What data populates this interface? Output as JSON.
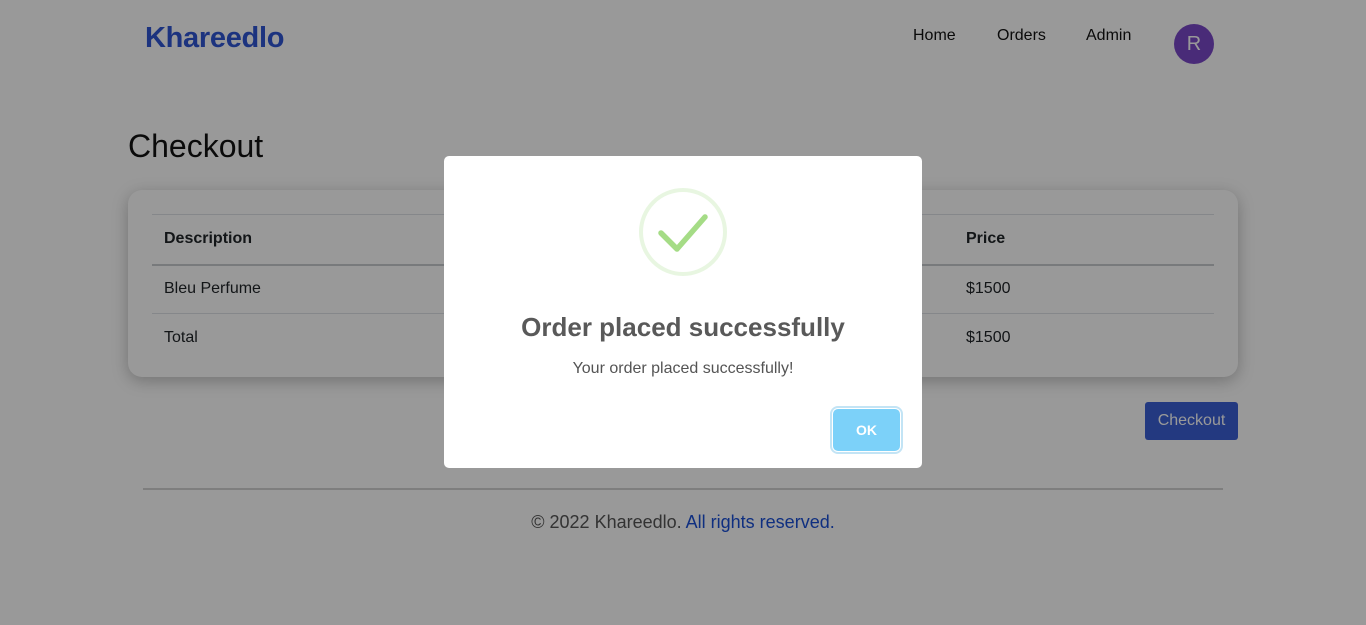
{
  "navbar": {
    "brand": "Khareedlo",
    "links": [
      "Home",
      "Orders",
      "Admin"
    ],
    "avatar_initial": "R"
  },
  "page": {
    "title": "Checkout"
  },
  "table": {
    "headers": [
      "Description",
      "Price"
    ],
    "rows": [
      [
        "Bleu Perfume",
        "$1500"
      ],
      [
        "Total",
        "$1500"
      ]
    ]
  },
  "checkout_button": "Checkout",
  "footer": {
    "copyright": "© 2022 Khareedlo.",
    "rights": "All rights reserved."
  },
  "modal": {
    "icon": "success-check-icon",
    "title": "Order placed successfully",
    "text": "Your order placed successfully!",
    "ok_label": "OK"
  },
  "colors": {
    "brand": "#2f55d4",
    "avatar": "#7b48c8",
    "checkout_button": "#3b5fd6",
    "ok_button": "#7cd1f9",
    "success_check": "#a5dc86"
  }
}
